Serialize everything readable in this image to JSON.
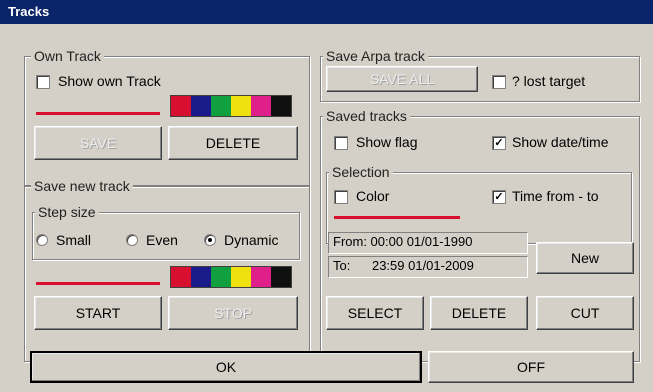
{
  "window": {
    "title": "Tracks"
  },
  "own_track": {
    "legend": "Own Track",
    "show_label": "Show own Track",
    "show_checked": false,
    "save_label": "SAVE",
    "delete_label": "DELETE",
    "line_color": "#d81030",
    "palette": [
      "#d81030",
      "#1a1a8a",
      "#10a040",
      "#f0e010",
      "#e0208a",
      "#101010"
    ]
  },
  "save_new": {
    "legend": "Save new track",
    "step_legend": "Step size",
    "options": [
      "Small",
      "Even",
      "Dynamic"
    ],
    "selected": "Dynamic",
    "start_label": "START",
    "stop_label": "STOP",
    "line_color": "#d81030",
    "palette": [
      "#d81030",
      "#1a1a8a",
      "#10a040",
      "#f0e010",
      "#e0208a",
      "#101010"
    ]
  },
  "arpa": {
    "legend": "Save Arpa track",
    "save_all_label": "SAVE ALL",
    "lost_target_label": "? lost target",
    "lost_target_checked": false
  },
  "saved_tracks": {
    "legend": "Saved tracks",
    "show_flag_label": "Show flag",
    "show_flag_checked": false,
    "show_datetime_label": "Show date/time",
    "show_datetime_checked": true,
    "selection_legend": "Selection",
    "color_label": "Color",
    "color_checked": false,
    "time_label": "Time from - to",
    "time_checked": true,
    "line_color": "#d81030",
    "from_text": "From: 00:00 01/01-1990",
    "to_label": "To:",
    "to_value": "23:59 01/01-2009",
    "new_label": "New",
    "select_label": "SELECT",
    "delete_label": "DELETE",
    "cut_label": "CUT"
  },
  "footer": {
    "ok_label": "OK",
    "off_label": "OFF"
  }
}
